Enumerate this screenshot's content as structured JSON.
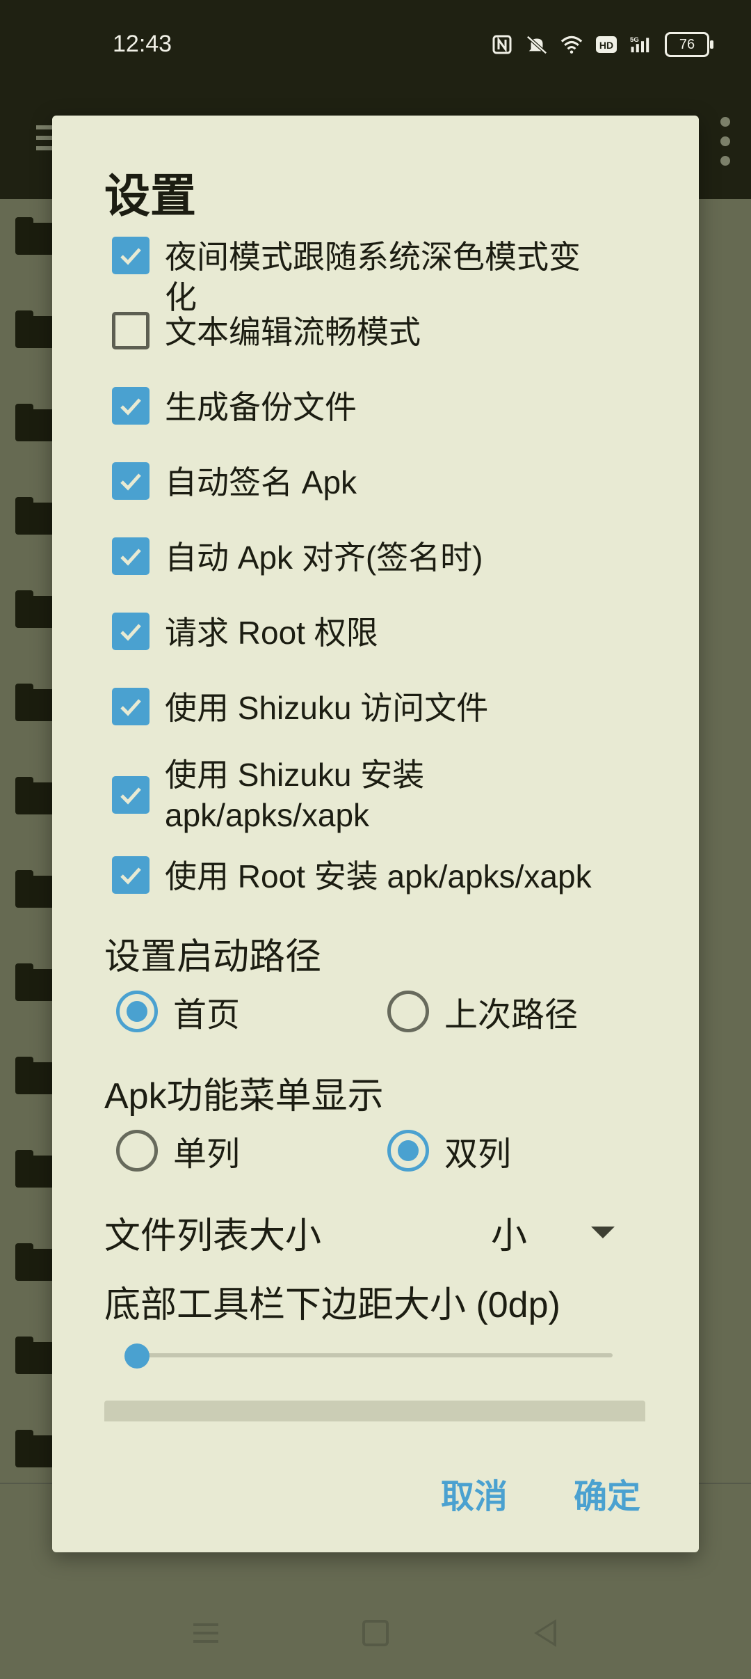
{
  "status": {
    "time": "12:43",
    "battery": "76",
    "icons": [
      "nfc-icon",
      "mute-icon",
      "wifi-icon",
      "hd-icon",
      "signal-5g-icon",
      "battery-icon"
    ]
  },
  "dialog": {
    "title": "设置",
    "checkboxes": [
      {
        "label": "夜间模式跟随系统深色模式变化",
        "checked": true
      },
      {
        "label": "文本编辑流畅模式",
        "checked": false
      },
      {
        "label": "生成备份文件",
        "checked": true
      },
      {
        "label": "自动签名 Apk",
        "checked": true
      },
      {
        "label": "自动 Apk 对齐(签名时)",
        "checked": true
      },
      {
        "label": "请求 Root 权限",
        "checked": true
      },
      {
        "label": "使用 Shizuku 访问文件",
        "checked": true
      },
      {
        "label": "使用 Shizuku 安装 apk/apks/xapk",
        "checked": true
      },
      {
        "label": "使用 Root 安装 apk/apks/xapk",
        "checked": true
      }
    ],
    "startup_path": {
      "label": "设置启动路径",
      "options": [
        "首页",
        "上次路径"
      ],
      "selected": "首页"
    },
    "apk_menu": {
      "label": "Apk功能菜单显示",
      "options": [
        "单列",
        "双列"
      ],
      "selected": "双列"
    },
    "file_list_size": {
      "label": "文件列表大小",
      "value": "小"
    },
    "bottom_margin": {
      "label": "底部工具栏下边距大小 (0dp)",
      "value": 0
    },
    "cancel": "取消",
    "ok": "确定"
  },
  "colors": {
    "accent": "#4aa1d0",
    "dialog_bg": "#e8ead3",
    "scrim_bg": "#666a52"
  }
}
